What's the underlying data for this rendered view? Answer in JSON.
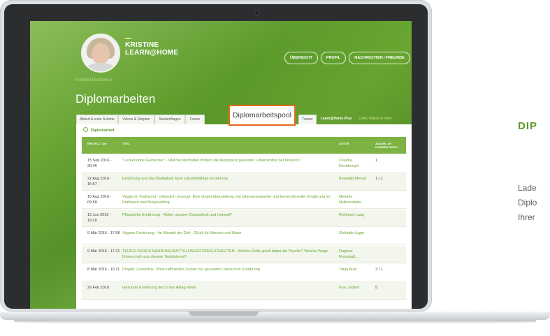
{
  "profile": {
    "edit_link": "Profilbild bearbeiten",
    "brand_line1": "KRISTINE",
    "brand_line2": "LEARN@HOME"
  },
  "topnav": {
    "items": [
      {
        "label": "ÜBERSICHT"
      },
      {
        "label": "PROFIL"
      },
      {
        "label": "NACHRICHTEN / FREUNDE"
      }
    ]
  },
  "page": {
    "title": "Diplomarbeiten"
  },
  "tabs": [
    {
      "label": "Ablauf & erste Schritte"
    },
    {
      "label": "Videos & Skripten"
    },
    {
      "label": "Studienfragen"
    },
    {
      "label": "Forum"
    },
    {
      "label": "Diplomarbeitspool"
    },
    {
      "label": "Trainer"
    },
    {
      "label": "Learn@Home Plus"
    },
    {
      "label": "Links, Videos & mehr"
    }
  ],
  "breadcrumb": "Diplomarbeit",
  "table": {
    "headers": [
      "ERSTELLT AM",
      "TITEL",
      "AUTOR",
      "ANZAHL AN KOMMENTAREN"
    ],
    "rows": [
      {
        "date": "15 Sep 2016 - 20:46",
        "title": "\"Lecker ohne Gemecker\" - Welche Methoden fördern die Akzeptanz gesunder Lebensmittel bei Kindern?",
        "author": "Claudia Rechberger",
        "count": "1"
      },
      {
        "date": "22 Aug 2016 - 15:57",
        "title": "Ernährung und Nachhaltigkeit: Eine zukunftsfähige Ernährung",
        "author": "Benedikt Meinel",
        "count": "1 / 1"
      },
      {
        "date": "16 Aug 2016 - 09:58",
        "title": "Vegan im Kraftsport - pflanzlich versorgt: Eine Gegenüberstellung von pflanzenbasierter und konventioneller Ernährung im Kraftsport und Bodybuilding",
        "author": "Melanie Muthershaler",
        "count": ""
      },
      {
        "date": "13 Jun 2016 - 19:20",
        "title": "Pflanzliche Ernährung - Retter unserer Gesundheit und Umwelt?",
        "author": "Reinhard Lang",
        "count": ""
      },
      {
        "date": "9 Mär 2016 - 17:58",
        "title": "Vegane Ernährung - Im Wandel der Zeit - Glück für Mensch und Natur",
        "author": "Gerlinde Luger",
        "count": ""
      },
      {
        "date": "9 Mär 2016 - 17:21",
        "title": "TEUFELSKREIS NAHRUNGSMITTELUNVERTRÄGLICHKEITEN - Welche Rolle spielt dabei die Psyche? Welche Wege führen mich aus diesem Teufelskreis?",
        "author": "Dagmar Reinstadl...",
        "count": ""
      },
      {
        "date": "8 Mär 2016 - 10:11",
        "title": "Projekt: Zuckerfrei. Ohne raffinierten Zucker zur gesunden, basischen Ernährung",
        "author": "Tanja Auer",
        "count": "3 / 1"
      },
      {
        "date": "29 Feb 2016",
        "title": "Gesunde Ernährung durch den Alltag leben",
        "author": "Eva Lindner",
        "count": "5"
      }
    ]
  },
  "side": {
    "title": "DIP",
    "lines": [
      "Lade",
      "Diplo",
      "Ihrer"
    ]
  },
  "colors": {
    "brand_green": "#5c9a2a",
    "highlight_orange": "#e56b1f",
    "table_header": "#7cb342"
  }
}
